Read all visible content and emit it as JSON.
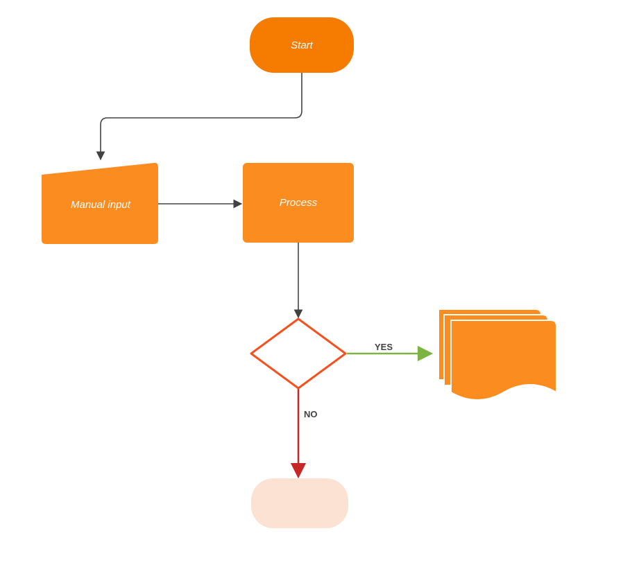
{
  "flowchart": {
    "nodes": {
      "start": {
        "label": "Start",
        "type": "terminator",
        "fill": "#f57c00"
      },
      "manual_input": {
        "label": "Manual input",
        "type": "manual-input",
        "fill": "#fb8c20"
      },
      "process": {
        "label": "Process",
        "type": "process",
        "fill": "#fb8c20"
      },
      "decision": {
        "label": "",
        "type": "decision",
        "stroke": "#f4511e"
      },
      "documents": {
        "label": "",
        "type": "multi-document",
        "fill": "#fb8c20"
      },
      "end": {
        "label": "",
        "type": "terminator",
        "fill": "#fbe2d2"
      }
    },
    "edges": {
      "start_to_input": {
        "label": "",
        "color": "#424242"
      },
      "input_to_process": {
        "label": "",
        "color": "#424242"
      },
      "process_to_decision": {
        "label": "",
        "color": "#424242"
      },
      "decision_yes": {
        "label": "YES",
        "color": "#7cb342"
      },
      "decision_no": {
        "label": "NO",
        "color": "#c62828"
      }
    }
  }
}
